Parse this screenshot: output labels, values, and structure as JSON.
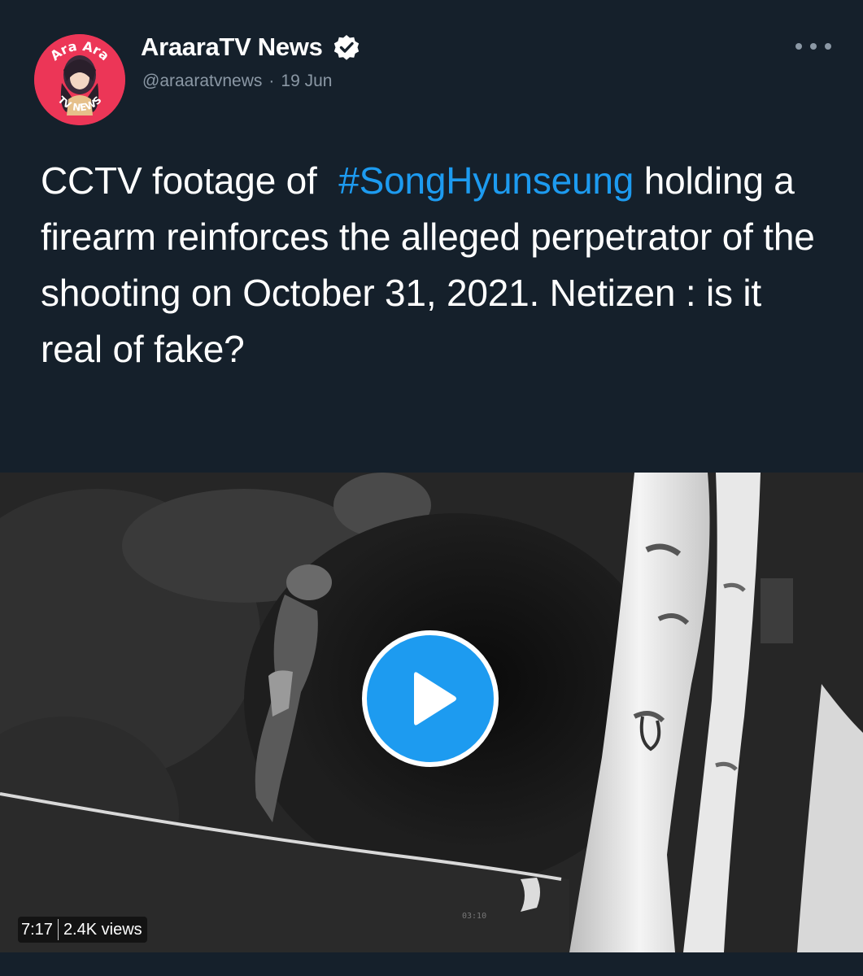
{
  "author": {
    "display_name": "AraaraTV News",
    "handle": "@araaratvnews",
    "separator": "·",
    "date": "19 Jun",
    "verified": true,
    "avatar_text_top": "Ara Ara",
    "avatar_text_bottom": "TV NEWS"
  },
  "tweet": {
    "text_before_hashtag": "CCTV footage of",
    "hashtag": "#SongHyunseung",
    "text_after_hashtag": "holding a firearm reinforces the alleged perpetrator of the shooting on October 31, 2021. Netizen : is it real of fake?"
  },
  "video": {
    "duration": "7:17",
    "views": "2.4K views"
  },
  "icons": {
    "verified": "verified-badge-icon",
    "more": "more-options-icon",
    "play": "play-icon"
  },
  "colors": {
    "background": "#15202b",
    "link": "#1d9bf0",
    "secondary_text": "#8b98a5",
    "avatar_bg": "#ec3657"
  }
}
